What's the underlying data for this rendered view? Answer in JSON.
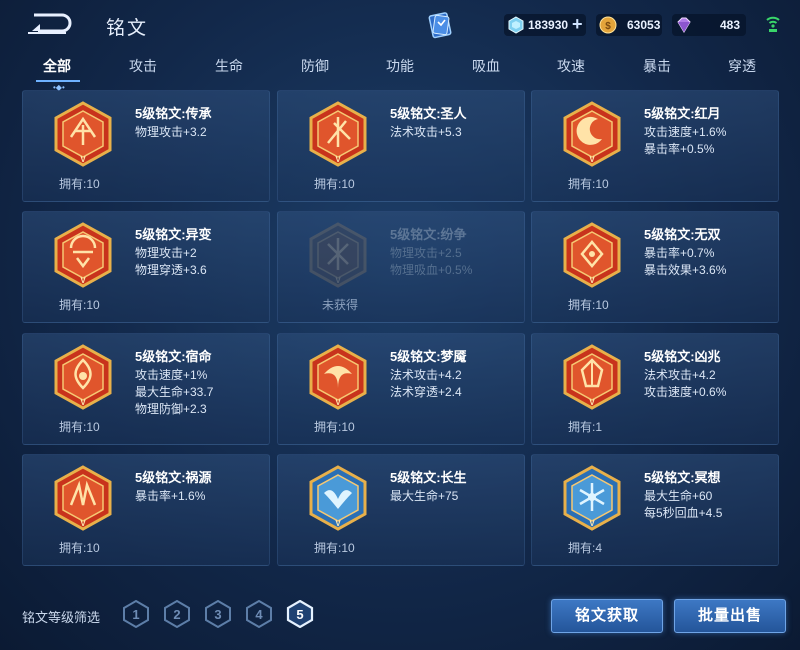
{
  "header": {
    "title": "铭文",
    "currency": [
      {
        "icon": "diamond-icon",
        "value": "183930"
      },
      {
        "icon": "gold-coin-icon",
        "value": "63053"
      },
      {
        "icon": "gem-icon",
        "value": "483"
      }
    ],
    "add_label": "+"
  },
  "tabs": [
    {
      "label": "全部",
      "active": true
    },
    {
      "label": "攻击"
    },
    {
      "label": "生命"
    },
    {
      "label": "防御"
    },
    {
      "label": "功能"
    },
    {
      "label": "吸血"
    },
    {
      "label": "攻速"
    },
    {
      "label": "暴击"
    },
    {
      "label": "穿透"
    }
  ],
  "runes": [
    {
      "name": "5级铭文:传承",
      "stats": [
        "物理攻击+3.2"
      ],
      "owned": "拥有:10",
      "color": "red"
    },
    {
      "name": "5级铭文:圣人",
      "stats": [
        "法术攻击+5.3"
      ],
      "owned": "拥有:10",
      "color": "red"
    },
    {
      "name": "5级铭文:红月",
      "stats": [
        "攻击速度+1.6%",
        "暴击率+0.5%"
      ],
      "owned": "拥有:10",
      "color": "red"
    },
    {
      "name": "5级铭文:异变",
      "stats": [
        "物理攻击+2",
        "物理穿透+3.6"
      ],
      "owned": "拥有:10",
      "color": "red"
    },
    {
      "name": "5级铭文:纷争",
      "stats": [
        "物理攻击+2.5",
        "物理吸血+0.5%"
      ],
      "owned": "未获得",
      "color": "locked"
    },
    {
      "name": "5级铭文:无双",
      "stats": [
        "暴击率+0.7%",
        "暴击效果+3.6%"
      ],
      "owned": "拥有:10",
      "color": "red"
    },
    {
      "name": "5级铭文:宿命",
      "stats": [
        "攻击速度+1%",
        "最大生命+33.7",
        "物理防御+2.3"
      ],
      "owned": "拥有:10",
      "color": "red"
    },
    {
      "name": "5级铭文:梦魇",
      "stats": [
        "法术攻击+4.2",
        "法术穿透+2.4"
      ],
      "owned": "拥有:10",
      "color": "red"
    },
    {
      "name": "5级铭文:凶兆",
      "stats": [
        "法术攻击+4.2",
        "攻击速度+0.6%"
      ],
      "owned": "拥有:1",
      "color": "red"
    },
    {
      "name": "5级铭文:祸源",
      "stats": [
        "暴击率+1.6%"
      ],
      "owned": "拥有:10",
      "color": "red"
    },
    {
      "name": "5级铭文:长生",
      "stats": [
        "最大生命+75"
      ],
      "owned": "拥有:10",
      "color": "blue"
    },
    {
      "name": "5级铭文:冥想",
      "stats": [
        "最大生命+60",
        "每5秒回血+4.5"
      ],
      "owned": "拥有:4",
      "color": "blue"
    }
  ],
  "footer": {
    "filter_label": "铭文等级筛选",
    "levels": [
      "1",
      "2",
      "3",
      "4",
      "5"
    ],
    "selected_level": "5",
    "get_button": "铭文获取",
    "sell_button": "批量出售"
  },
  "colors": {
    "accent": "#6fb2ff",
    "rune_red": "#c8331c",
    "rune_blue": "#2a6fb5",
    "rune_gold": "#e8b04a"
  }
}
